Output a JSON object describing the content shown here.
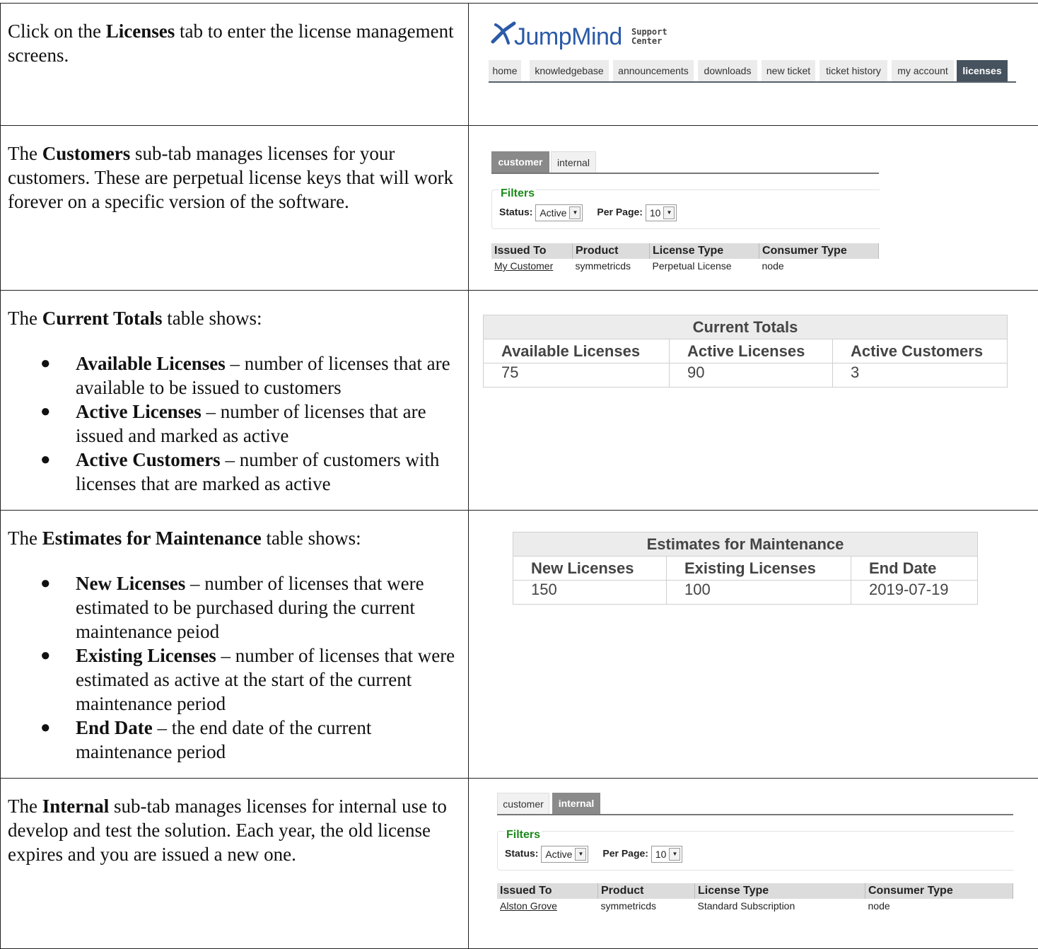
{
  "rows": [
    {
      "text": {
        "p1": "Click on the ",
        "b1": "Licenses",
        "p2": " tab to enter the license management screens."
      }
    },
    {
      "text": {
        "p1": "The ",
        "b1": "Customers",
        "p2": " sub-tab manages licenses for your customers.  These are perpetual license keys that will work forever on a specific version of the software."
      }
    },
    {
      "text": {
        "p1": "The ",
        "b1": "Current Totals",
        "p2": " table shows:"
      },
      "bullets": [
        {
          "term": "Available Licenses",
          "desc": " – number of licenses that are available to be issued to customers"
        },
        {
          "term": "Active Licenses",
          "desc": " – number of licenses that are issued and marked as active"
        },
        {
          "term": "Active Customers",
          "desc": " – number of customers with licenses that are marked as active"
        }
      ]
    },
    {
      "text": {
        "p1": "The ",
        "b1": "Estimates for Maintenance",
        "p2": " table shows:"
      },
      "bullets": [
        {
          "term": "New Licenses",
          "desc": " – number of licenses that were estimated to be purchased during the current maintenance peiod"
        },
        {
          "term": "Existing Licenses",
          "desc": " – number of licenses that were estimated as active at the start of the current maintenance period"
        },
        {
          "term": "End Date",
          "desc": " – the end date of the current maintenance period"
        }
      ]
    },
    {
      "text": {
        "p1": "The ",
        "b1": "Internal",
        "p2": " sub-tab manages licenses for internal use to develop and test the solution.  Each year, the old license expires and you are issued a new one."
      }
    }
  ],
  "header": {
    "logo_text": "JumpMind",
    "logo_sub1": "Support",
    "logo_sub2": "Center",
    "nav": [
      "home",
      "knowledgebase",
      "announcements",
      "downloads",
      "new ticket",
      "ticket history",
      "my account",
      "licenses"
    ]
  },
  "customer_panel": {
    "tabs": [
      "customer",
      "internal"
    ],
    "filters_title": "Filters",
    "status_label": "Status:",
    "status_value": "Active",
    "perpage_label": "Per Page:",
    "perpage_value": "10",
    "columns": [
      "Issued To",
      "Product",
      "License Type",
      "Consumer Type"
    ],
    "row": [
      "My Customer",
      "symmetricds",
      "Perpetual License",
      "node"
    ]
  },
  "totals": {
    "title": "Current Totals",
    "headers": [
      "Available Licenses",
      "Active Licenses",
      "Active Customers"
    ],
    "values": [
      "75",
      "90",
      "3"
    ]
  },
  "estimates": {
    "title": "Estimates for Maintenance",
    "headers": [
      "New Licenses",
      "Existing Licenses",
      "End Date"
    ],
    "values": [
      "150",
      "100",
      "2019-07-19"
    ]
  },
  "internal_panel": {
    "tabs": [
      "customer",
      "internal"
    ],
    "filters_title": "Filters",
    "status_label": "Status:",
    "status_value": "Active",
    "perpage_label": "Per Page:",
    "perpage_value": "10",
    "columns": [
      "Issued To",
      "Product",
      "License Type",
      "Consumer Type"
    ],
    "row": [
      "Alston Grove",
      "symmetricds",
      "Standard Subscription",
      "node"
    ]
  },
  "colors": {
    "logo_blue": "#2b5aa8",
    "nav_active": "#46535f",
    "filters_green": "#1a8a1a"
  }
}
